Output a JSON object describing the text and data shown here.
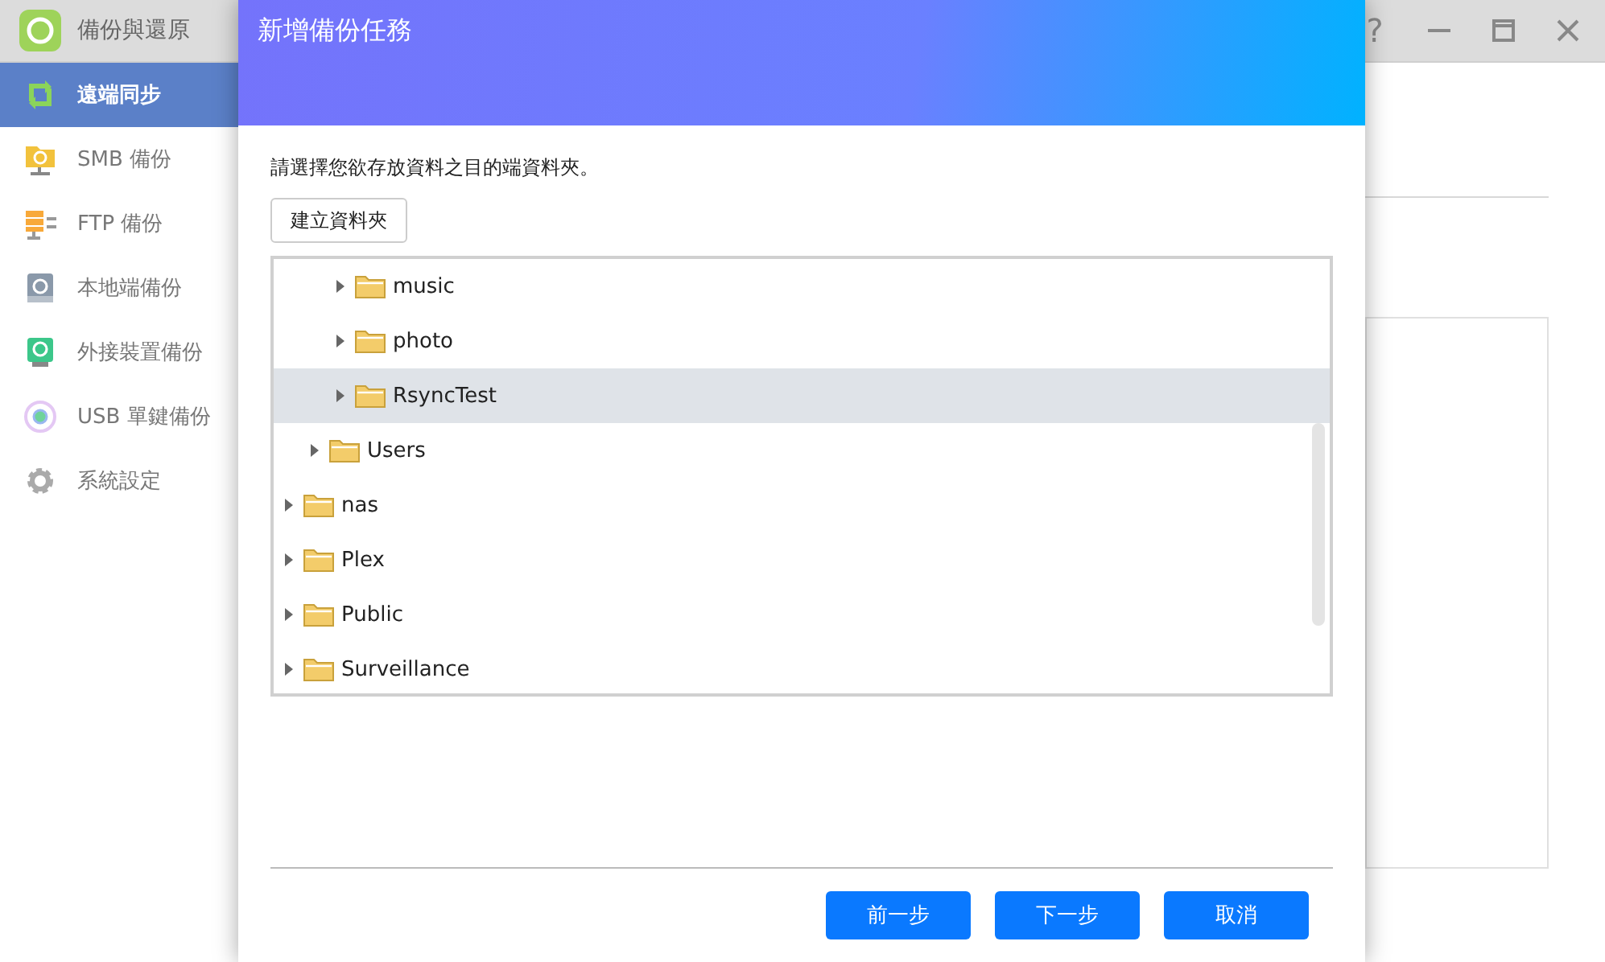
{
  "app": {
    "title": "備份與還原",
    "controls": [
      {
        "kind": "help",
        "label": "?"
      },
      {
        "kind": "minimize"
      },
      {
        "kind": "maximize"
      },
      {
        "kind": "close"
      }
    ]
  },
  "sidebar": {
    "items": [
      {
        "label": "遠端同步",
        "kind": "sync",
        "selected": true
      },
      {
        "label": "SMB 備份",
        "kind": "smb",
        "selected": false
      },
      {
        "label": "FTP 備份",
        "kind": "ftp",
        "selected": false
      },
      {
        "label": "本地端備份",
        "kind": "local",
        "selected": false
      },
      {
        "label": "外接裝置備份",
        "kind": "external",
        "selected": false
      },
      {
        "label": "USB 單鍵備份",
        "kind": "usb",
        "selected": false
      },
      {
        "label": "系統設定",
        "kind": "settings",
        "selected": false
      }
    ]
  },
  "dialog": {
    "title": "新增備份任務",
    "instruction": "請選擇您欲存放資料之目的端資料夾。",
    "create_folder_button": "建立資料夾",
    "tree": {
      "items": [
        {
          "children": [
            {
              "children": [
                {
                  "label": "music",
                  "expanded": false,
                  "selected": false
                },
                {
                  "label": "photo",
                  "expanded": false,
                  "selected": false
                },
                {
                  "label": "RsyncTest",
                  "expanded": false,
                  "selected": true
                }
              ]
            },
            {
              "label": "Users",
              "expanded": false,
              "selected": false
            }
          ]
        },
        {
          "label": "nas",
          "expanded": false,
          "selected": false
        },
        {
          "label": "Plex",
          "expanded": false,
          "selected": false
        },
        {
          "label": "Public",
          "expanded": false,
          "selected": false
        },
        {
          "label": "Surveillance",
          "expanded": false,
          "selected": false
        }
      ]
    },
    "buttons": [
      "前一步",
      "下一步",
      "取消"
    ]
  }
}
